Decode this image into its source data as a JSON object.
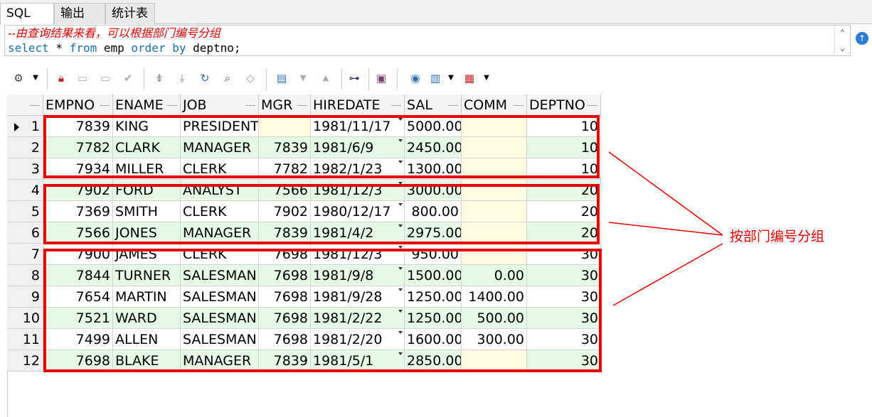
{
  "tabs": [
    "SQL",
    "输出",
    "统计表"
  ],
  "editor": {
    "comment": "--由查询结果来看，可以根据部门编号分组",
    "sql_kw1": "select",
    "sql_p1": " * ",
    "sql_kw2": "from",
    "sql_p2": " emp ",
    "sql_kw3": "order by",
    "sql_p3": " deptno;"
  },
  "toolbar": {
    "icons": [
      "grid-options-icon",
      "lock-icon",
      "insert-record-icon",
      "delete-record-icon",
      "post-icon",
      "fetch-next-icon",
      "fetch-last-icon",
      "refresh-icon",
      "find-icon",
      "clear-icon",
      "save-icon",
      "sort-desc-icon",
      "sort-asc-icon",
      "tree-icon",
      "export-icon",
      "query-icon",
      "chart-icon",
      "table-view-icon"
    ]
  },
  "grid": {
    "columns": [
      "EMPNO",
      "ENAME",
      "JOB",
      "MGR",
      "HIREDATE",
      "SAL",
      "COMM",
      "DEPTNO"
    ],
    "rows": [
      [
        "1",
        "7839",
        "KING",
        "PRESIDENT",
        "",
        "1981/11/17",
        "5000.00",
        "",
        "10"
      ],
      [
        "2",
        "7782",
        "CLARK",
        "MANAGER",
        "7839",
        "1981/6/9",
        "2450.00",
        "",
        "10"
      ],
      [
        "3",
        "7934",
        "MILLER",
        "CLERK",
        "7782",
        "1982/1/23",
        "1300.00",
        "",
        "10"
      ],
      [
        "4",
        "7902",
        "FORD",
        "ANALYST",
        "7566",
        "1981/12/3",
        "3000.00",
        "",
        "20"
      ],
      [
        "5",
        "7369",
        "SMITH",
        "CLERK",
        "7902",
        "1980/12/17",
        "800.00",
        "",
        "20"
      ],
      [
        "6",
        "7566",
        "JONES",
        "MANAGER",
        "7839",
        "1981/4/2",
        "2975.00",
        "",
        "20"
      ],
      [
        "7",
        "7900",
        "JAMES",
        "CLERK",
        "7698",
        "1981/12/3",
        "950.00",
        "",
        "30"
      ],
      [
        "8",
        "7844",
        "TURNER",
        "SALESMAN",
        "7698",
        "1981/9/8",
        "1500.00",
        "0.00",
        "30"
      ],
      [
        "9",
        "7654",
        "MARTIN",
        "SALESMAN",
        "7698",
        "1981/9/28",
        "1250.00",
        "1400.00",
        "30"
      ],
      [
        "10",
        "7521",
        "WARD",
        "SALESMAN",
        "7698",
        "1981/2/22",
        "1250.00",
        "500.00",
        "30"
      ],
      [
        "11",
        "7499",
        "ALLEN",
        "SALESMAN",
        "7698",
        "1981/2/20",
        "1600.00",
        "300.00",
        "30"
      ],
      [
        "12",
        "7698",
        "BLAKE",
        "MANAGER",
        "7839",
        "1981/5/1",
        "2850.00",
        "",
        "30"
      ]
    ]
  },
  "annotation": {
    "label": "按部门编号分组",
    "color": "#e60000"
  }
}
